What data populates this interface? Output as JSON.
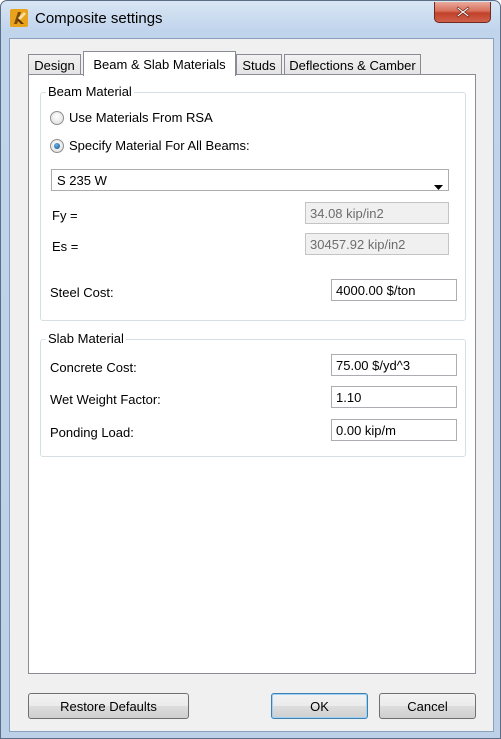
{
  "window": {
    "title": "Composite settings",
    "icon": "autodesk-robot-icon",
    "close_icon": "close-icon"
  },
  "tabs": [
    {
      "label": "Design",
      "active": false
    },
    {
      "label": "Beam & Slab Materials",
      "active": true
    },
    {
      "label": "Studs",
      "active": false
    },
    {
      "label": "Deflections & Camber",
      "active": false
    }
  ],
  "beam_material": {
    "group_label": "Beam Material",
    "option_rsa": {
      "label": "Use Materials From RSA",
      "checked": false
    },
    "option_all": {
      "label": "Specify Material For All Beams:",
      "checked": true
    },
    "material_select": {
      "value": "S 235 W"
    },
    "fy": {
      "label": "Fy =",
      "value": "34.08 kip/in2"
    },
    "es": {
      "label": "Es =",
      "value": "30457.92 kip/in2"
    },
    "steel_cost": {
      "label": "Steel Cost:",
      "value": "4000.00 $/ton"
    }
  },
  "slab_material": {
    "group_label": "Slab Material",
    "concrete_cost": {
      "label": "Concrete Cost:",
      "value": "75.00 $/yd^3"
    },
    "wet_weight_factor": {
      "label": "Wet Weight Factor:",
      "value": "1.10"
    },
    "ponding_load": {
      "label": "Ponding Load:",
      "value": "0.00 kip/m"
    }
  },
  "buttons": {
    "restore": "Restore Defaults",
    "ok": "OK",
    "cancel": "Cancel"
  },
  "colors": {
    "title_bar": "#c0d4ec",
    "close_button": "#c9513a",
    "radio_checked": "#1d5f9a"
  }
}
